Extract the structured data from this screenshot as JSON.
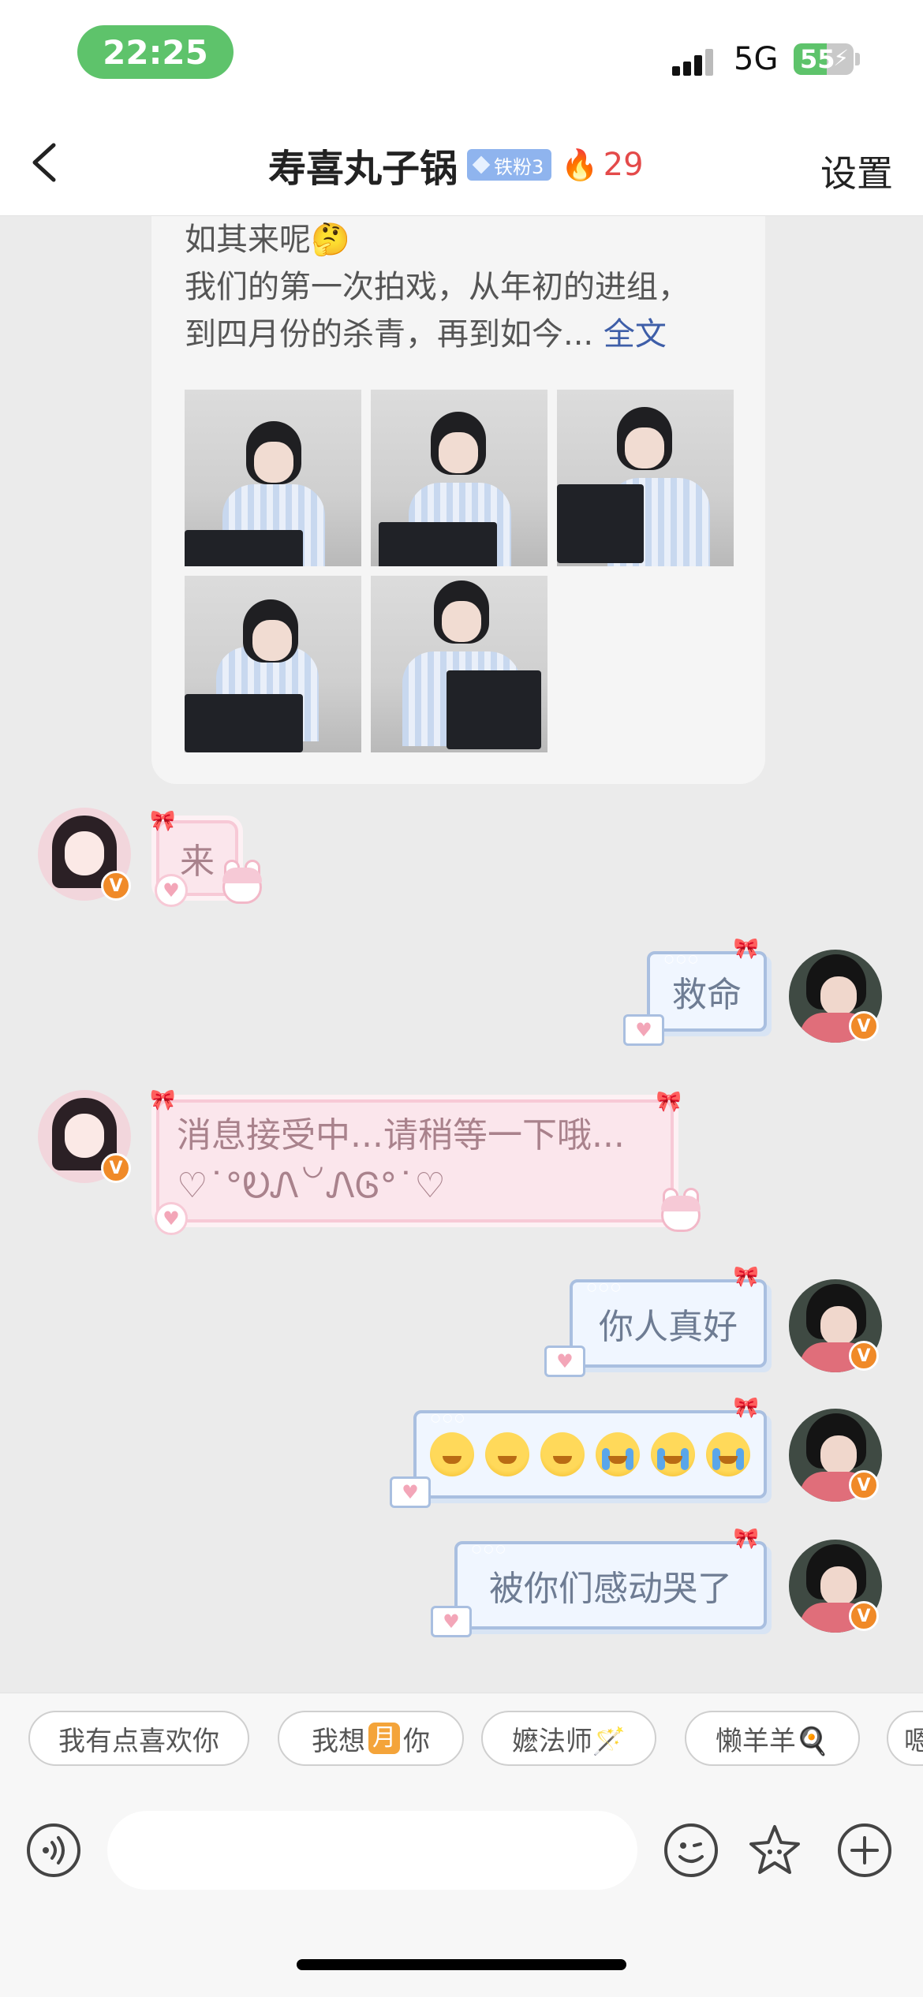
{
  "status_bar": {
    "time": "22:25",
    "network": "5G",
    "battery_text": "55",
    "battery_level": 0.55,
    "colors": {
      "time_pill": "#5ec36b",
      "battery_fill": "#5ec36b"
    }
  },
  "nav": {
    "title": "寿喜丸子锅",
    "fan_badge": "铁粉3",
    "fire_count": "29",
    "settings_label": "设置"
  },
  "shared_post": {
    "line1": "如其来呢🤔",
    "line2": "我们的第一次拍戏，从年初的进组，",
    "line3_text": "到四月份的杀青，再到如今...",
    "line3_more": "全文",
    "image_count": 5
  },
  "messages": [
    {
      "side": "left",
      "text": "来",
      "style": "pink"
    },
    {
      "side": "right",
      "text": "救命",
      "style": "blue"
    },
    {
      "side": "left",
      "line1": "消息接受中...请稍等一下哦...",
      "line2": "♡˙°ᎧᏁ꒡ᏁᎶ°˙♡",
      "style": "pink"
    },
    {
      "side": "right",
      "text": "你人真好",
      "style": "blue"
    },
    {
      "side": "right",
      "text": "emoji",
      "emojis": [
        "pleading",
        "pleading",
        "pleading",
        "crying",
        "crying",
        "crying"
      ],
      "style": "blue"
    },
    {
      "side": "right",
      "text": "被你们感动哭了",
      "style": "blue"
    }
  ],
  "quick_replies": {
    "chip1": "我有点喜欢你",
    "chip2_a": "我想",
    "chip2_moon": "月",
    "chip2_b": "你",
    "chip3": "嬷法师🪄",
    "chip4": "懒羊羊🍳",
    "chip5": "嗯"
  },
  "input": {
    "placeholder": ""
  },
  "icons": [
    "back-icon",
    "voice-icon",
    "emoji-icon",
    "sticker-star-icon",
    "plus-icon",
    "verified-v-icon"
  ]
}
